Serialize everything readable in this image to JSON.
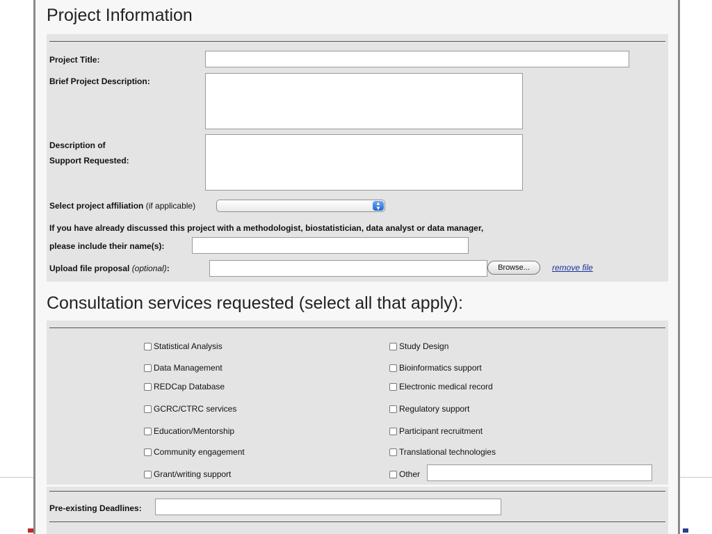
{
  "window": {
    "title": "Project Information"
  },
  "project": {
    "title_label": "Project Title:",
    "title_value": "",
    "brief_label": "Brief Project Description:",
    "brief_value": "",
    "support_label_line1": "Description of",
    "support_label_line2": "Support Requested:",
    "support_value": "",
    "affiliation_label": "Select project affiliation",
    "affiliation_hint": "(if applicable)",
    "affiliation_selected": "",
    "discussed_line1": "If you have already discussed this project with a methodologist, biostatistician, data analyst or data manager,",
    "discussed_line2": "please include their name(s):",
    "discussed_value": "",
    "upload_label": "Upload file proposal",
    "upload_hint": "(optional)",
    "upload_colon": ":",
    "upload_value": "",
    "browse_label": "Browse...",
    "remove_label": "remove file"
  },
  "consultation": {
    "title": "Consultation services requested (select all that apply):",
    "left": [
      "Statistical Analysis",
      "Data Management",
      "REDCap Database",
      "GCRC/CTRC services",
      "Education/Mentorship",
      "Community engagement",
      "Grant/writing support"
    ],
    "right": [
      "Study Design",
      "Bioinformatics support",
      "Electronic medical record",
      "Regulatory support",
      "Participant recruitment",
      "Translational technologies",
      "Other"
    ],
    "other_value": ""
  },
  "deadlines": {
    "label": "Pre-existing Deadlines:",
    "value": ""
  }
}
